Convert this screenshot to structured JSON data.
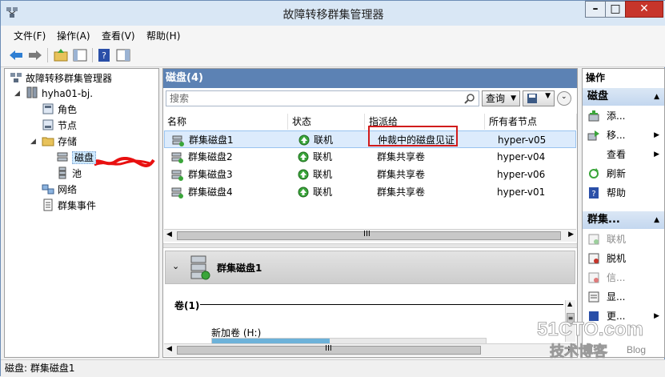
{
  "window": {
    "title": "故障转移群集管理器"
  },
  "menu": [
    "文件(F)",
    "操作(A)",
    "查看(V)",
    "帮助(H)"
  ],
  "tree": {
    "root": "故障转移群集管理器",
    "cluster": "hyha01-bj.",
    "items": [
      "角色",
      "节点",
      "存储",
      "磁盘",
      "池",
      "网络",
      "群集事件"
    ]
  },
  "center": {
    "header": "磁盘(4)",
    "search_placeholder": "搜索",
    "query_label": "查询",
    "columns": [
      "名称",
      "状态",
      "指派给",
      "所有者节点"
    ],
    "rows": [
      {
        "name": "群集磁盘1",
        "status": "联机",
        "assigned": "仲裁中的磁盘见证",
        "owner": "hyper-v05"
      },
      {
        "name": "群集磁盘2",
        "status": "联机",
        "assigned": "群集共享卷",
        "owner": "hyper-v04"
      },
      {
        "name": "群集磁盘3",
        "status": "联机",
        "assigned": "群集共享卷",
        "owner": "hyper-v06"
      },
      {
        "name": "群集磁盘4",
        "status": "联机",
        "assigned": "群集共享卷",
        "owner": "hyper-v01"
      }
    ],
    "detail_title": "群集磁盘1",
    "volume_section": "卷(1)",
    "volume_item": "新加卷 (H:)",
    "volume_fill_fraction": 0.43
  },
  "actions": {
    "title": "操作",
    "group1": "磁盘",
    "group1_items": [
      "添...",
      "移...",
      "查看",
      "刷新",
      "帮助"
    ],
    "group2": "群集...",
    "group2_items": [
      "联机",
      "脱机",
      "信...",
      "显...",
      "更..."
    ]
  },
  "statusbar": {
    "text": "磁盘:  群集磁盘1"
  },
  "watermark": {
    "line1": "51CTO.com",
    "line2": "技术博客",
    "line3": "Blog"
  },
  "colors": {
    "header_blue": "#5c82b4",
    "selection": "#dcebfc",
    "highlight_red": "#d11b1b",
    "online_green": "#3aa53a"
  }
}
